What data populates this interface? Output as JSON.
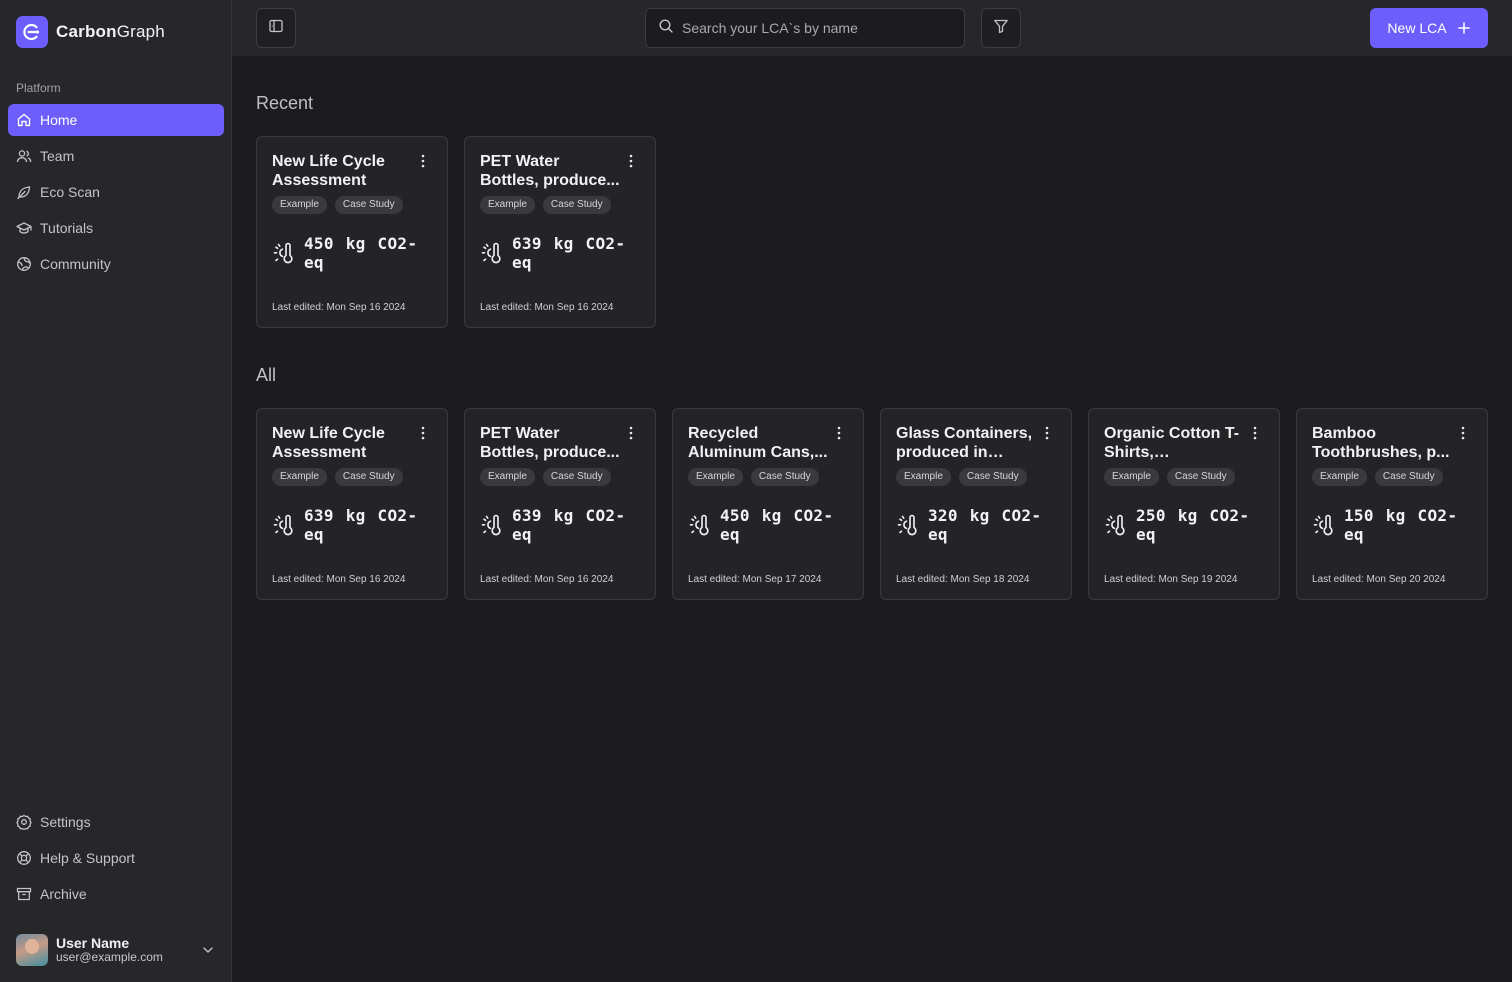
{
  "brand": {
    "name_bold": "Carbon",
    "name_rest": "Graph"
  },
  "sidebar": {
    "section_label": "Platform",
    "items": [
      {
        "label": "Home",
        "icon": "home-icon",
        "active": true
      },
      {
        "label": "Team",
        "icon": "users-icon"
      },
      {
        "label": "Eco Scan",
        "icon": "leaf-icon"
      },
      {
        "label": "Tutorials",
        "icon": "graduation-cap-icon"
      },
      {
        "label": "Community",
        "icon": "globe-icon"
      }
    ],
    "bottom_items": [
      {
        "label": "Settings",
        "icon": "gear-icon"
      },
      {
        "label": "Help & Support",
        "icon": "life-buoy-icon"
      },
      {
        "label": "Archive",
        "icon": "archive-icon"
      }
    ],
    "user": {
      "name": "User Name",
      "email": "user@example.com"
    }
  },
  "topbar": {
    "search_placeholder": "Search your LCA`s by name",
    "new_button_label": "New LCA"
  },
  "colors": {
    "accent": "#6d5efc",
    "background": "#1c1c1e",
    "sidebar": "#27272a"
  },
  "recent": {
    "heading": "Recent",
    "cards": [
      {
        "title": "New Life Cycle Assessment",
        "tags": [
          "Example",
          "Case Study"
        ],
        "emission": "450 kg CO2-eq",
        "edited": "Last edited: Mon Sep 16 2024"
      },
      {
        "title": "PET Water Bottles, produce...",
        "tags": [
          "Example",
          "Case Study"
        ],
        "emission": "639 kg CO2-eq",
        "edited": "Last edited: Mon Sep 16 2024"
      }
    ]
  },
  "all": {
    "heading": "All",
    "cards": [
      {
        "title": "New Life Cycle Assessment",
        "tags": [
          "Example",
          "Case Study"
        ],
        "emission": "639 kg CO2-eq",
        "edited": "Last edited: Mon Sep 16 2024"
      },
      {
        "title": "PET Water Bottles, produce...",
        "tags": [
          "Example",
          "Case Study"
        ],
        "emission": "639 kg CO2-eq",
        "edited": "Last edited: Mon Sep 16 2024"
      },
      {
        "title": "Recycled Aluminum Cans,...",
        "tags": [
          "Example",
          "Case Study"
        ],
        "emission": "450 kg CO2-eq",
        "edited": "Last edited: Mon Sep 17 2024"
      },
      {
        "title": "Glass Containers, produced in Fran...",
        "tags": [
          "Example",
          "Case Study"
        ],
        "emission": "320 kg CO2-eq",
        "edited": "Last edited: Mon Sep 18 2024"
      },
      {
        "title": "Organic Cotton T-Shirts, produced...",
        "tags": [
          "Example",
          "Case Study"
        ],
        "emission": "250 kg CO2-eq",
        "edited": "Last edited: Mon Sep 19 2024"
      },
      {
        "title": "Bamboo Toothbrushes, p...",
        "tags": [
          "Example",
          "Case Study"
        ],
        "emission": "150 kg CO2-eq",
        "edited": "Last edited: Mon Sep 20 2024"
      }
    ]
  }
}
